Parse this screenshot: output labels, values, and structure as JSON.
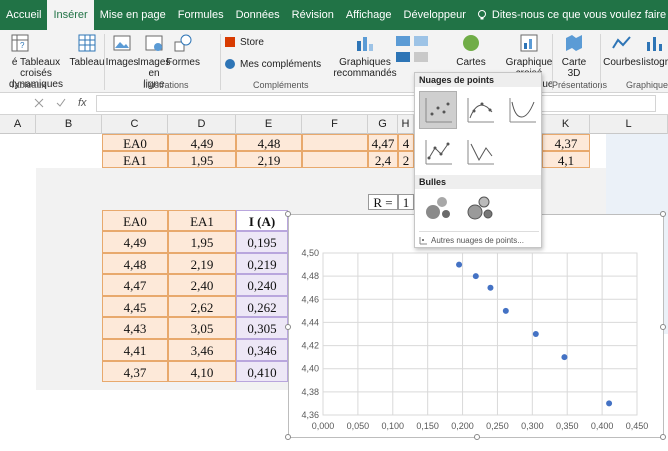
{
  "tabs": [
    "Accueil",
    "Insérer",
    "Mise en page",
    "Formules",
    "Données",
    "Révision",
    "Affichage",
    "Développeur"
  ],
  "tell_me": "Dites-nous ce que vous voulez faire",
  "ribbon": {
    "pivot_rec": "é Tableaux croisés dynamiques",
    "table": "Tableau",
    "images": "Images",
    "images_online": "Images en ligne",
    "formes": "Formes",
    "store": "Store",
    "mes_complements": "Mes compléments",
    "graph_recommandes": "Graphiques recommandés",
    "cartes": "Cartes",
    "graph_croise": "Graphique croisé dynamique",
    "carte3d": "Carte 3D",
    "courbes": "Courbes",
    "histogra": "Histogra",
    "grp_tableaux": "Tableaux",
    "grp_illustrations": "Illustrations",
    "grp_complements": "Compléments",
    "grp_presentations": "Présentations",
    "grp_graphiques": "Graphiques s"
  },
  "formula_bar": {
    "fx": "fx"
  },
  "columns": [
    "A",
    "B",
    "C",
    "D",
    "E",
    "F",
    "G",
    "H",
    "K",
    "L"
  ],
  "top_rows": [
    {
      "label": "EA0",
      "d": "4,49",
      "e": "4,48",
      "g": "4,47",
      "h": "4",
      "k": "4,37"
    },
    {
      "label": "EA1",
      "d": "1,95",
      "e": "2,19",
      "g": "2,4",
      "h": "2",
      "k": "4,1"
    }
  ],
  "r_label": "R =",
  "r_value": "1",
  "table": {
    "headers": [
      "EA0",
      "EA1",
      "I (A)"
    ],
    "rows": [
      [
        "4,49",
        "1,95",
        "0,195"
      ],
      [
        "4,48",
        "2,19",
        "0,219"
      ],
      [
        "4,47",
        "2,40",
        "0,240"
      ],
      [
        "4,45",
        "2,62",
        "0,262"
      ],
      [
        "4,43",
        "3,05",
        "0,305"
      ],
      [
        "4,41",
        "3,46",
        "0,346"
      ],
      [
        "4,37",
        "4,10",
        "0,410"
      ]
    ]
  },
  "dropdown": {
    "section1": "Nuages de points",
    "section2": "Bulles",
    "more": "Autres nuages de points..."
  },
  "chart_data": {
    "type": "scatter",
    "x": [
      0.195,
      0.219,
      0.24,
      0.262,
      0.305,
      0.346,
      0.41
    ],
    "y": [
      4.49,
      4.48,
      4.47,
      4.45,
      4.43,
      4.41,
      4.37
    ],
    "xlim": [
      0,
      0.45
    ],
    "ylim": [
      4.36,
      4.5
    ],
    "xticks": [
      "0,000",
      "0,050",
      "0,100",
      "0,150",
      "0,200",
      "0,250",
      "0,300",
      "0,350",
      "0,400",
      "0,450"
    ],
    "yticks": [
      "4,36",
      "4,38",
      "4,40",
      "4,42",
      "4,44",
      "4,46",
      "4,48",
      "4,50"
    ],
    "grid": true,
    "marker_color": "#4472c4"
  }
}
